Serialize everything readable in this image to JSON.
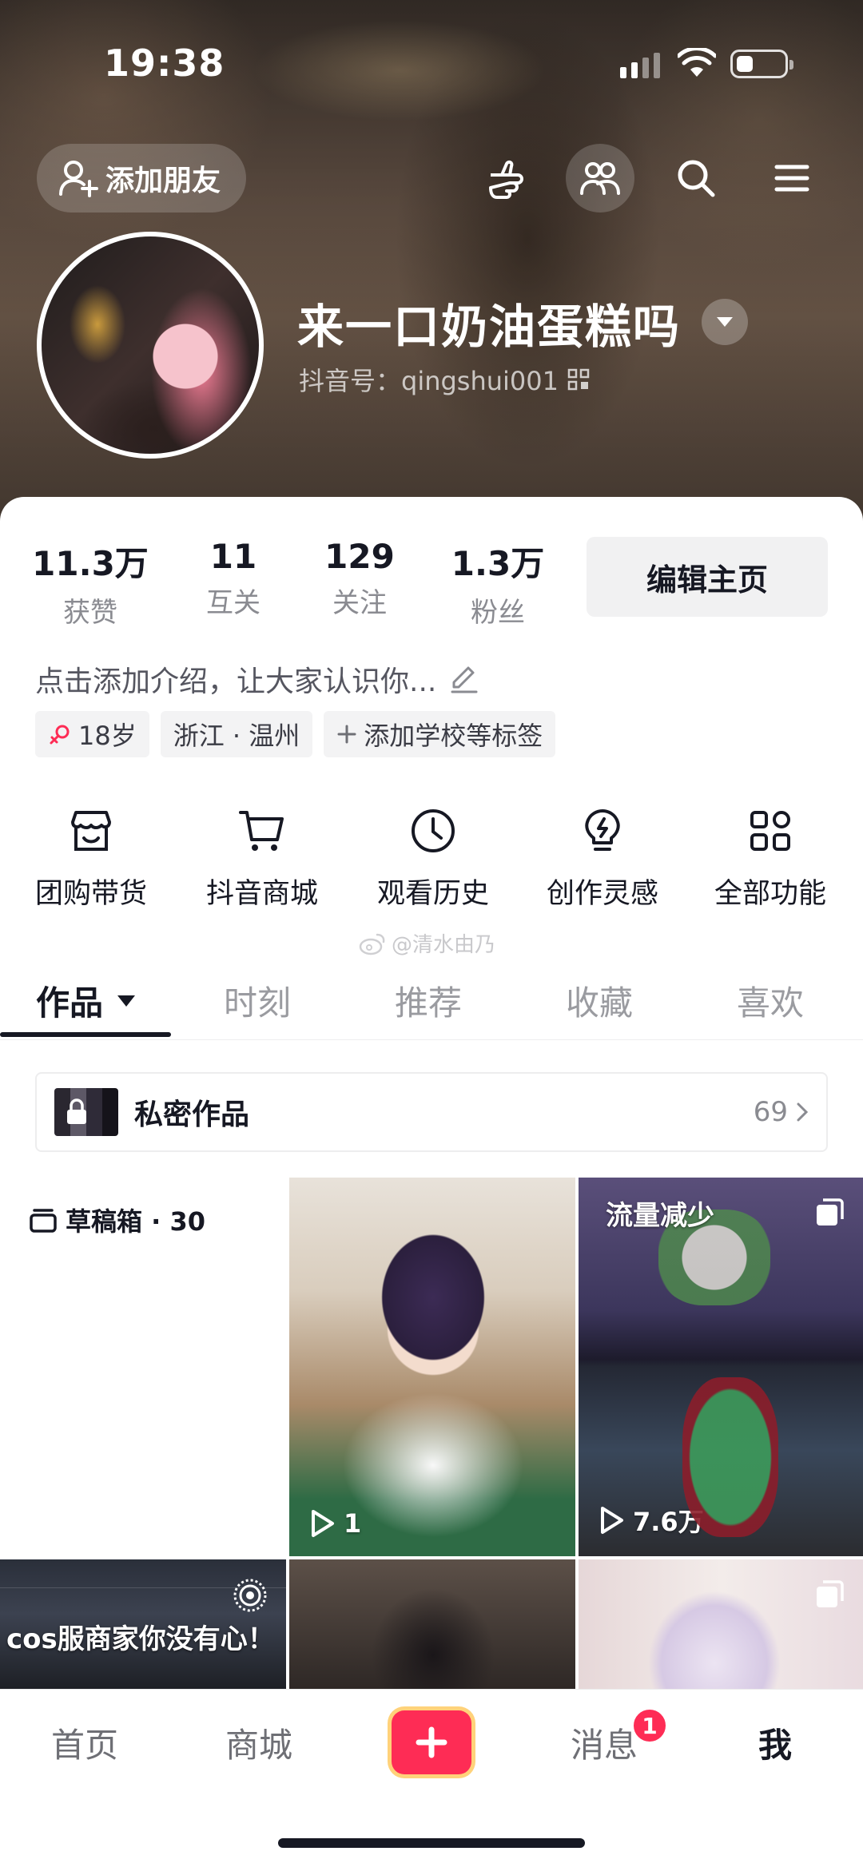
{
  "status_bar": {
    "time": "19:38"
  },
  "header": {
    "add_friend_label": "添加朋友",
    "nickname": "来一口奶油蛋糕吗",
    "douyin_id": "抖音号：qingshui001"
  },
  "stats": [
    {
      "num": "11.3万",
      "label": "获赞"
    },
    {
      "num": "11",
      "label": "互关"
    },
    {
      "num": "129",
      "label": "关注"
    },
    {
      "num": "1.3万",
      "label": "粉丝"
    }
  ],
  "edit_button": "编辑主页",
  "bio": "点击添加介绍，让大家认识你...",
  "tags": {
    "age": "18岁",
    "location": "浙江 · 温州",
    "school": "添加学校等标签"
  },
  "shortcuts": [
    "团购带货",
    "抖音商城",
    "观看历史",
    "创作灵感",
    "全部功能"
  ],
  "watermark": "@清水由乃",
  "tabs": [
    "作品",
    "时刻",
    "推荐",
    "收藏",
    "喜欢"
  ],
  "private_works": {
    "title": "私密作品",
    "count": "69"
  },
  "grid": {
    "drafts_label": "草稿箱 · 30",
    "cell2_plays": "1",
    "cell3_caption": "流量减少",
    "cell3_plays": "7.6万",
    "cell4_caption": "cos服商家你没有心！"
  },
  "bottom_nav": {
    "home": "首页",
    "mall": "商城",
    "messages": "消息",
    "messages_badge": "1",
    "me": "我"
  },
  "colors": {
    "accent": "#fe2c55",
    "text": "#161823",
    "muted": "#8a8b91"
  }
}
